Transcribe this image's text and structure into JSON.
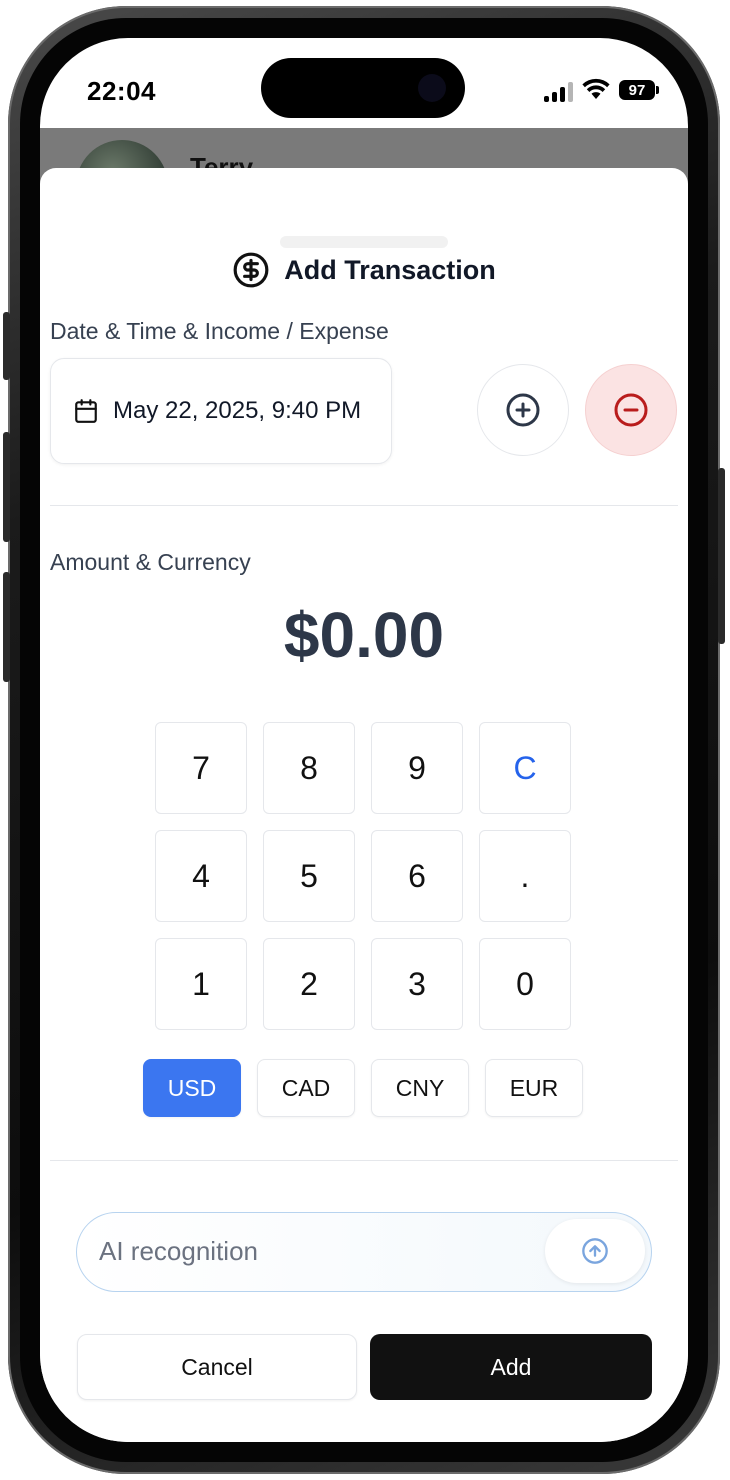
{
  "status_bar": {
    "time": "22:04",
    "battery": "97"
  },
  "background": {
    "name_partial": "Terry"
  },
  "sheet": {
    "title": "Add Transaction",
    "title_icon": "dollar-circle-icon",
    "date_section_label": "Date & Time & Income / Expense",
    "date_value": "May 22, 2025, 9:40 PM",
    "type_selected": "expense",
    "amount_section_label": "Amount & Currency",
    "amount": "$0.00",
    "keypad": [
      "7",
      "8",
      "9",
      "C",
      "4",
      "5",
      "6",
      ".",
      "1",
      "2",
      "3",
      "0"
    ],
    "currencies": [
      "USD",
      "CAD",
      "CNY",
      "EUR"
    ],
    "currency_selected": "USD",
    "ai_placeholder": "AI recognition",
    "cancel_label": "Cancel",
    "add_label": "Add"
  },
  "colors": {
    "accent_blue": "#3b76f0",
    "clear_key": "#2563eb",
    "expense_red": "#b91c1c",
    "expense_bg": "#fbe3e3",
    "add_button": "#111111"
  }
}
